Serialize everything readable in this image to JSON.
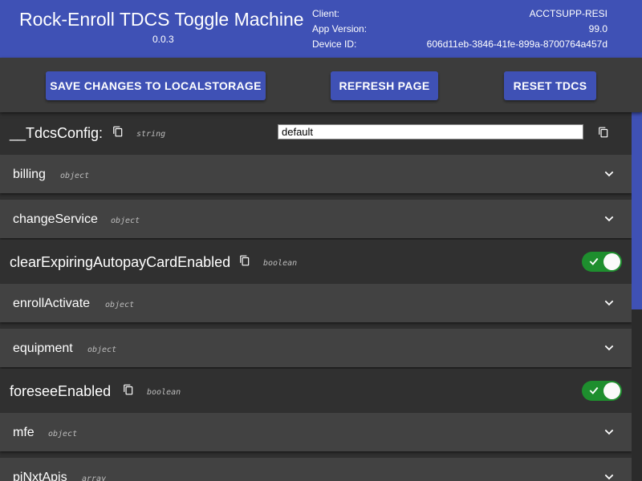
{
  "header": {
    "title": "Rock-Enroll TDCS Toggle Machine",
    "version": "0.0.3",
    "info": [
      {
        "label": "Client:",
        "value": "ACCTSUPP-RESI"
      },
      {
        "label": "App Version:",
        "value": "99.0"
      },
      {
        "label": "Device ID:",
        "value": "606d11eb-3846-41fe-899a-8700764a457d"
      }
    ]
  },
  "toolbar": {
    "save_label": "SAVE CHANGES TO LOCALSTORAGE",
    "refresh_label": "REFRESH PAGE",
    "reset_label": "RESET TDCS"
  },
  "config": {
    "rows": [
      {
        "key": "__TdcsConfig:",
        "type": "string",
        "value": "default"
      },
      {
        "key": "billing",
        "type": "object"
      },
      {
        "key": "changeService",
        "type": "object"
      },
      {
        "key": "clearExpiringAutopayCardEnabled",
        "type": "boolean",
        "enabled": true
      },
      {
        "key": "enrollActivate",
        "type": "object"
      },
      {
        "key": "equipment",
        "type": "object"
      },
      {
        "key": "foreseeEnabled",
        "type": "boolean",
        "enabled": true
      },
      {
        "key": "mfe",
        "type": "object"
      },
      {
        "key": "piNxtApis",
        "type": "array"
      }
    ]
  },
  "colors": {
    "header_bg": "#3f51b5",
    "button_bg": "#3f51b5",
    "toggle_on": "#1e8e2e",
    "panel_bg": "#424242",
    "page_bg": "#303030"
  },
  "icons": {
    "copy": "copy-icon",
    "expand": "chevron-down-icon",
    "check": "check-icon"
  }
}
